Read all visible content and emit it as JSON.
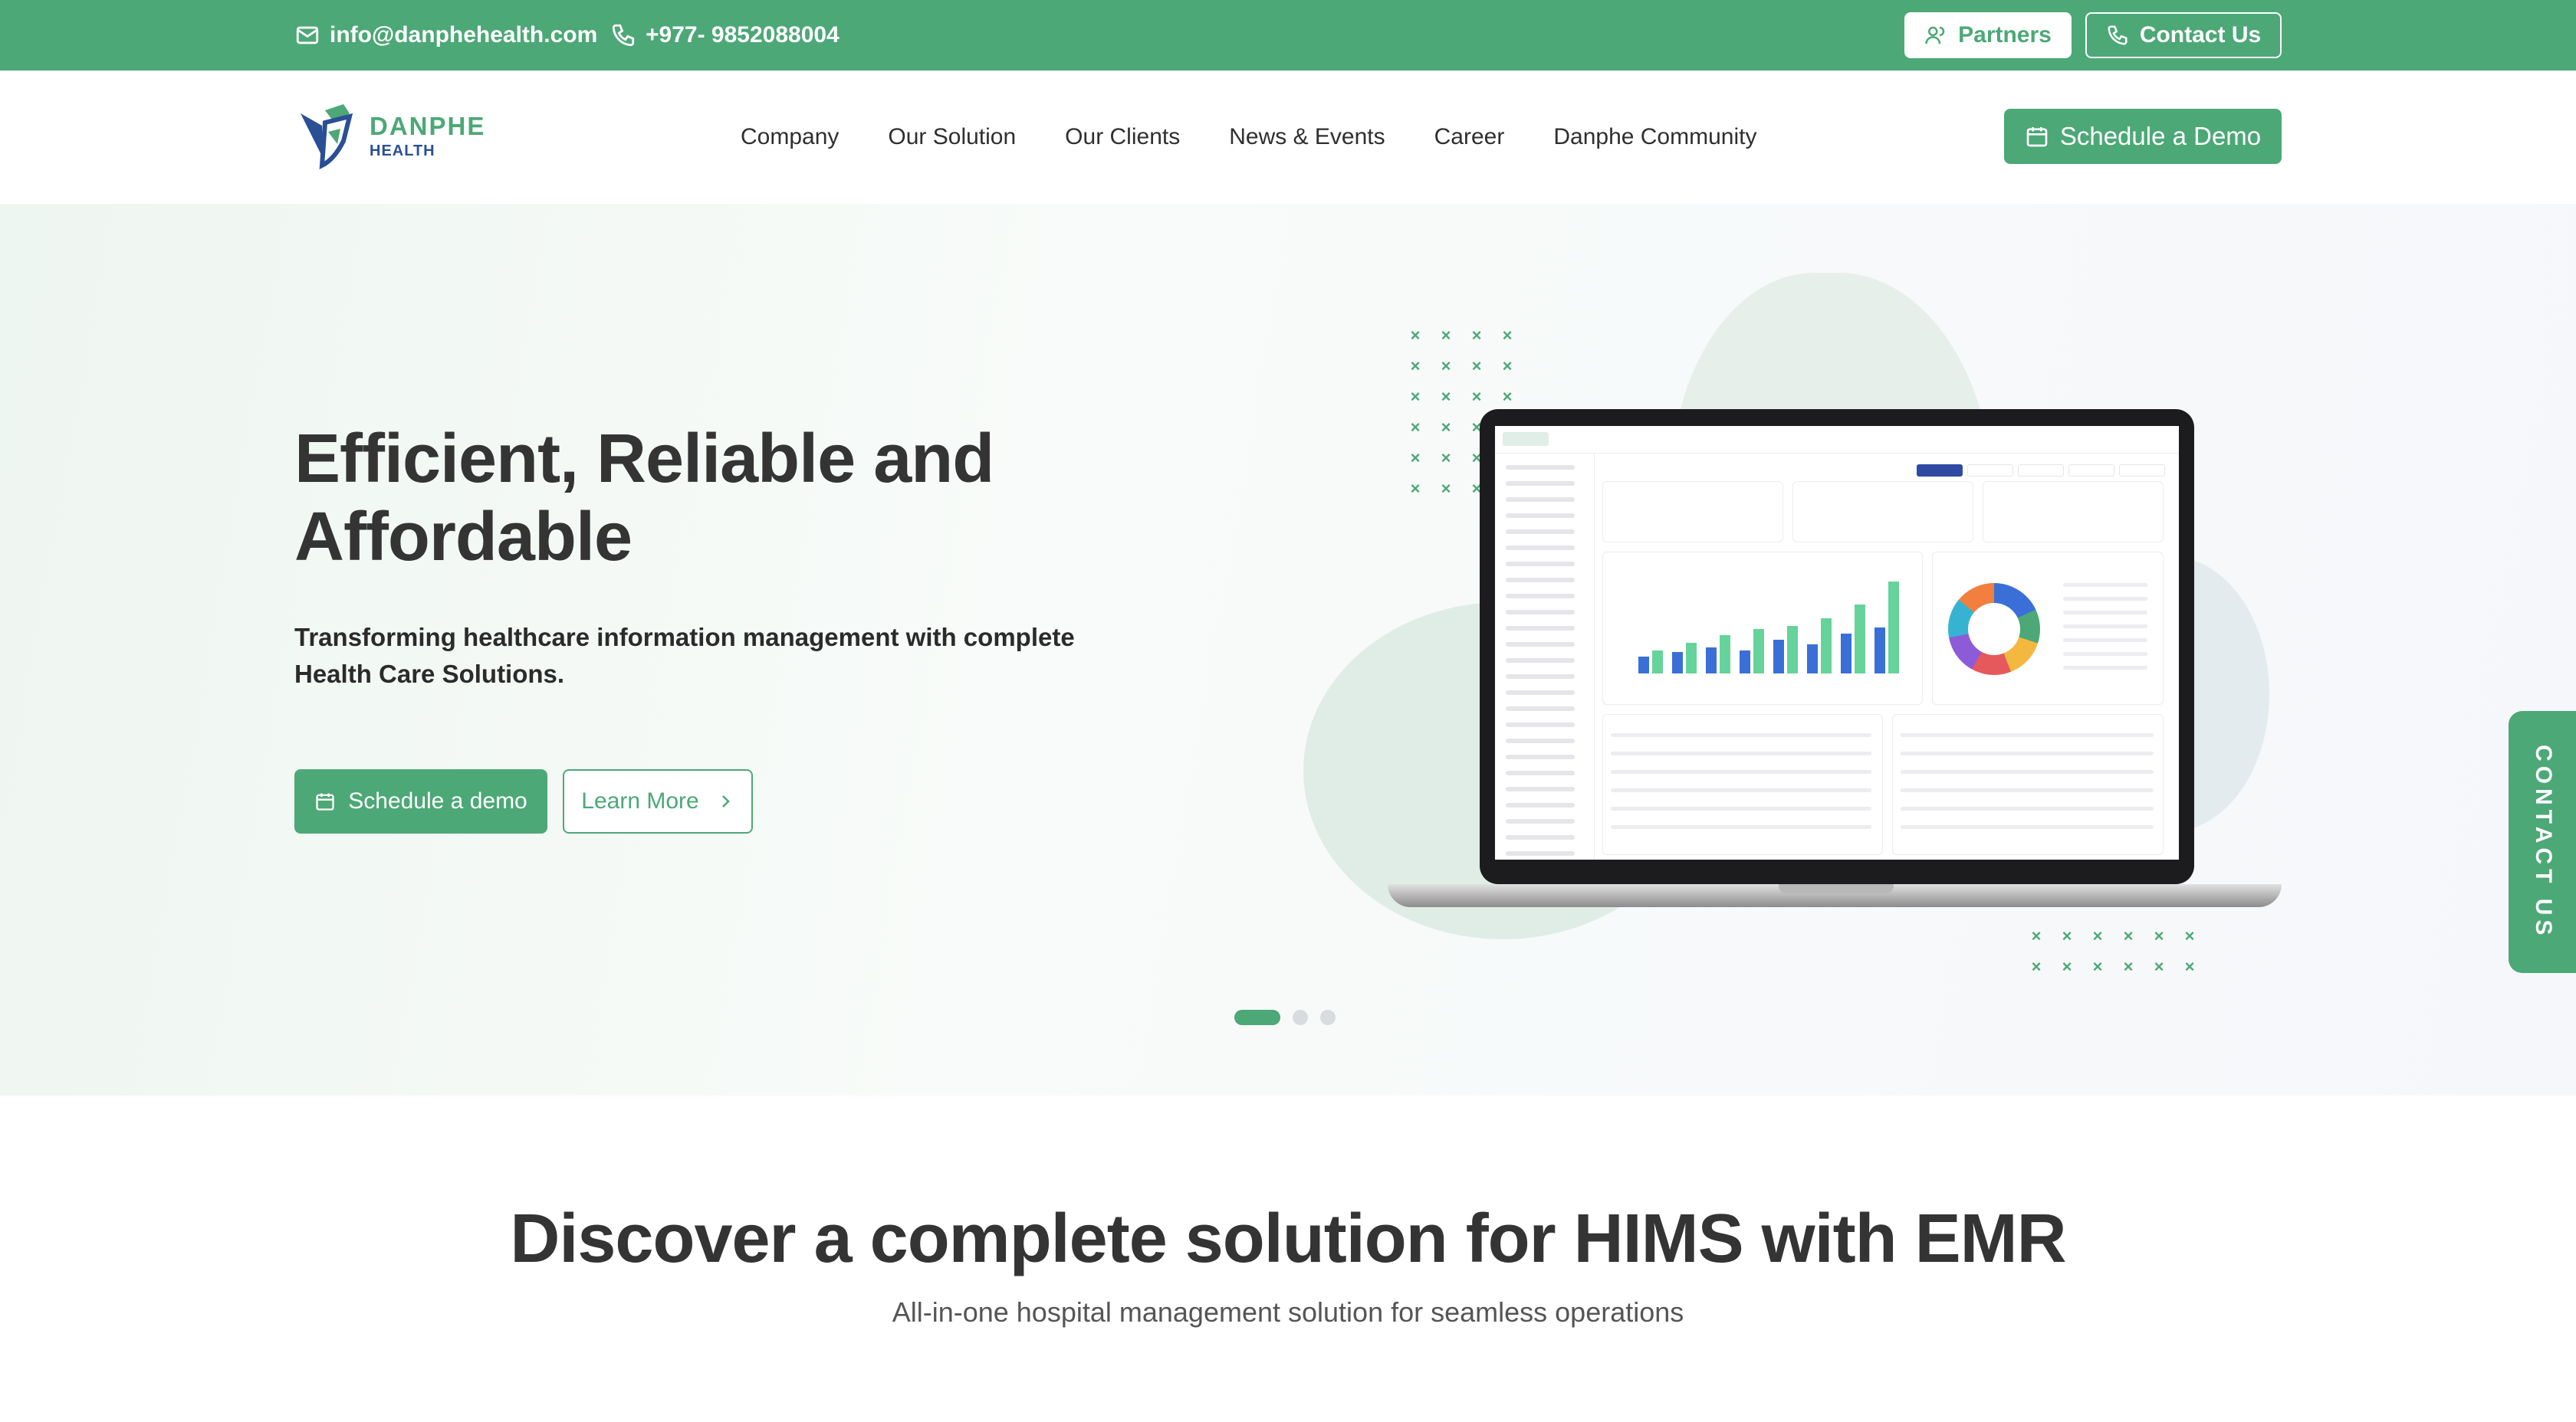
{
  "topbar": {
    "email": "info@danphehealth.com",
    "email_icon": "mail-icon",
    "phone": "+977- 9852088004",
    "phone_icon": "phone-icon",
    "partners_label": "Partners",
    "partners_icon": "users-icon",
    "contact_label": "Contact Us",
    "contact_icon": "phone-icon"
  },
  "brand": {
    "name_line1": "DANPHE",
    "name_line2": "HEALTH",
    "logo_icon": "danphe-bird-logo",
    "primary_color": "#4ca876",
    "secondary_color": "#2a4f95"
  },
  "nav": {
    "items": [
      {
        "label": "Company"
      },
      {
        "label": "Our Solution"
      },
      {
        "label": "Our Clients"
      },
      {
        "label": "News & Events"
      },
      {
        "label": "Career"
      },
      {
        "label": "Danphe Community"
      }
    ],
    "cta_label": "Schedule a Demo",
    "cta_icon": "calendar-icon"
  },
  "hero": {
    "title": "Efficient, Reliable and Affordable",
    "subtitle": "Transforming healthcare information management with complete Health Care Solutions.",
    "primary_button": "Schedule a demo",
    "primary_icon": "calendar-icon",
    "secondary_button": "Learn More",
    "secondary_icon": "chevron-right-icon",
    "carousel_slide": 1,
    "carousel_total": 3
  },
  "side_tab": {
    "label": "CONTACT US"
  },
  "section2": {
    "title": "Discover a complete solution for HIMS with EMR",
    "subtitle": "All-in-one hospital management solution for seamless operations"
  }
}
